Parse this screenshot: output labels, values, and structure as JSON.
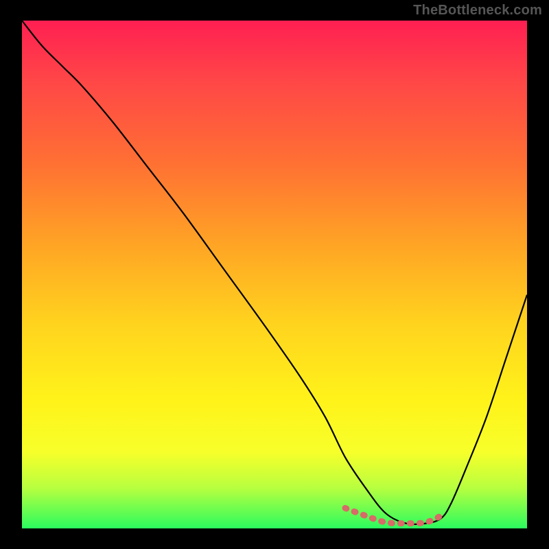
{
  "watermark": "TheBottleneck.com",
  "colors": {
    "page_bg": "#000000",
    "curve": "#000000",
    "valley_marker": "#d86a68",
    "watermark": "#565656"
  },
  "chart_data": {
    "type": "line",
    "title": "",
    "xlabel": "",
    "ylabel": "",
    "xlim": [
      0,
      100
    ],
    "ylim": [
      0,
      100
    ],
    "gradient_stops": [
      {
        "pct": 0,
        "color": "#ff1f52"
      },
      {
        "pct": 12,
        "color": "#ff4747"
      },
      {
        "pct": 28,
        "color": "#ff7033"
      },
      {
        "pct": 45,
        "color": "#ffa724"
      },
      {
        "pct": 60,
        "color": "#ffd41e"
      },
      {
        "pct": 75,
        "color": "#fff31a"
      },
      {
        "pct": 85,
        "color": "#f7ff2a"
      },
      {
        "pct": 92,
        "color": "#b8ff3f"
      },
      {
        "pct": 100,
        "color": "#2bfb5e"
      }
    ],
    "series": [
      {
        "name": "bottleneck-curve",
        "x": [
          0,
          4,
          8,
          12,
          18,
          25,
          32,
          40,
          48,
          55,
          60,
          64,
          68,
          72,
          76,
          80,
          83,
          85,
          88,
          92,
          96,
          100
        ],
        "y": [
          100,
          95,
          91,
          87,
          80,
          71,
          62,
          51,
          40,
          30,
          22,
          14,
          8,
          3,
          1,
          1,
          2,
          5,
          12,
          22,
          34,
          46
        ]
      }
    ],
    "valley_marker": {
      "x": [
        64,
        68,
        72,
        76,
        80,
        83
      ],
      "y": [
        4,
        2.5,
        1.2,
        1.0,
        1.2,
        2.5
      ]
    }
  }
}
